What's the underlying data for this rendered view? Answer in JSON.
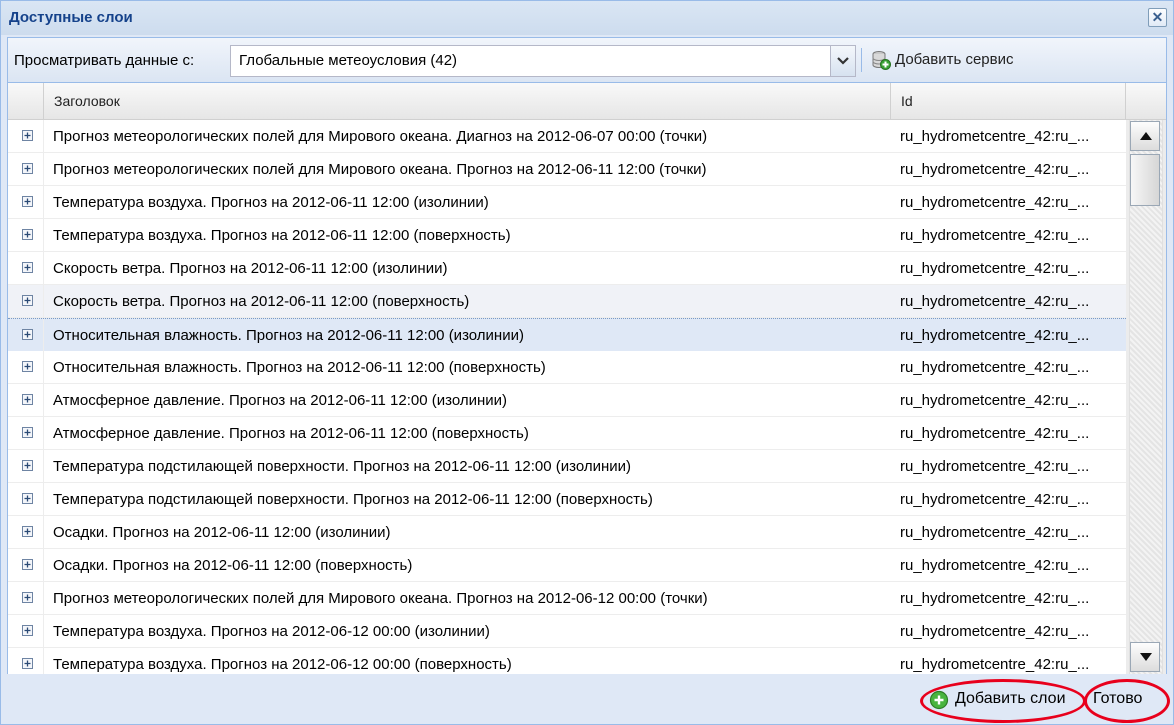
{
  "window": {
    "title": "Доступные слои",
    "close_label": "✕"
  },
  "toolbar": {
    "source_label": "Просматривать данные с:",
    "source_value": "Глобальные метеоусловия (42)",
    "add_service_label": "Добавить сервис"
  },
  "grid": {
    "columns": [
      "Заголовок",
      "Id"
    ],
    "rows": [
      {
        "title": "Прогноз метеорологических полей для Мирового океана. Диагноз на 2012-06-07 00:00 (точки)",
        "id": "ru_hydrometcentre_42:ru_..."
      },
      {
        "title": "Прогноз метеорологических полей для Мирового океана. Прогноз на 2012-06-11 12:00 (точки)",
        "id": "ru_hydrometcentre_42:ru_..."
      },
      {
        "title": "Температура воздуха. Прогноз на 2012-06-11 12:00 (изолинии)",
        "id": "ru_hydrometcentre_42:ru_..."
      },
      {
        "title": "Температура воздуха. Прогноз на 2012-06-11 12:00 (поверхность)",
        "id": "ru_hydrometcentre_42:ru_..."
      },
      {
        "title": "Скорость ветра. Прогноз на 2012-06-11 12:00 (изолинии)",
        "id": "ru_hydrometcentre_42:ru_..."
      },
      {
        "title": "Скорость ветра. Прогноз на 2012-06-11 12:00 (поверхность)",
        "id": "ru_hydrometcentre_42:ru_..."
      },
      {
        "title": "Относительная влажность. Прогноз на 2012-06-11 12:00 (изолинии)",
        "id": "ru_hydrometcentre_42:ru_..."
      },
      {
        "title": "Относительная влажность. Прогноз на 2012-06-11 12:00 (поверхность)",
        "id": "ru_hydrometcentre_42:ru_..."
      },
      {
        "title": "Атмосферное давление. Прогноз на 2012-06-11 12:00 (изолинии)",
        "id": "ru_hydrometcentre_42:ru_..."
      },
      {
        "title": "Атмосферное давление. Прогноз на 2012-06-11 12:00 (поверхность)",
        "id": "ru_hydrometcentre_42:ru_..."
      },
      {
        "title": "Температура подстилающей поверхности. Прогноз на 2012-06-11 12:00 (изолинии)",
        "id": "ru_hydrometcentre_42:ru_..."
      },
      {
        "title": "Температура подстилающей поверхности. Прогноз на 2012-06-11 12:00 (поверхность)",
        "id": "ru_hydrometcentre_42:ru_..."
      },
      {
        "title": "Осадки. Прогноз на 2012-06-11 12:00 (изолинии)",
        "id": "ru_hydrometcentre_42:ru_..."
      },
      {
        "title": "Осадки. Прогноз на 2012-06-11 12:00 (поверхность)",
        "id": "ru_hydrometcentre_42:ru_..."
      },
      {
        "title": "Прогноз метеорологических полей для Мирового океана. Прогноз на 2012-06-12 00:00 (точки)",
        "id": "ru_hydrometcentre_42:ru_..."
      },
      {
        "title": "Температура воздуха. Прогноз на 2012-06-12 00:00 (изолинии)",
        "id": "ru_hydrometcentre_42:ru_..."
      },
      {
        "title": "Температура воздуха. Прогноз на 2012-06-12 00:00 (поверхность)",
        "id": "ru_hydrometcentre_42:ru_..."
      }
    ],
    "hovered_row_index": 5,
    "selected_row_index": 6
  },
  "footer": {
    "add_layers_label": "Добавить слои",
    "done_label": "Готово"
  },
  "icons": {
    "expand": "plus-square-icon",
    "add_service": "database-add-icon",
    "add_layers": "green-plus-circle-icon",
    "combo_trigger": "chevron-down-icon",
    "scroll_up": "triangle-up-icon",
    "scroll_down": "triangle-down-icon",
    "close": "close-icon"
  },
  "colors": {
    "title_text": "#15428b",
    "window_bg": "#dfe8f6",
    "border": "#99bbe8",
    "selected_row": "#dfe8f6",
    "highlight_ring": "#e8001c"
  }
}
